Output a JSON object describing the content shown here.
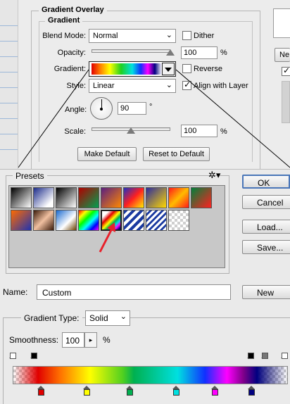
{
  "gradient_overlay": {
    "title": "Gradient Overlay",
    "subtitle": "Gradient",
    "blend_mode_label": "Blend Mode:",
    "blend_mode_value": "Normal",
    "dither_label": "Dither",
    "dither_checked": false,
    "opacity_label": "Opacity:",
    "opacity_value": "100",
    "opacity_unit": "%",
    "opacity_level": 1.0,
    "gradient_label": "Gradient:",
    "reverse_label": "Reverse",
    "reverse_checked": false,
    "style_label": "Style:",
    "style_value": "Linear",
    "align_label": "Align with Layer",
    "align_checked": true,
    "angle_label": "Angle:",
    "angle_value": "90",
    "angle_unit": "°",
    "scale_label": "Scale:",
    "scale_value": "100",
    "scale_unit": "%",
    "scale_level": 0.5,
    "make_default_label": "Make Default",
    "reset_default_label": "Reset to Default",
    "right_button_label": "Ne"
  },
  "gradient_editor": {
    "presets_label": "Presets",
    "presets_menu_icon": "gear-icon",
    "ok_label": "OK",
    "cancel_label": "Cancel",
    "load_label": "Load...",
    "save_label": "Save...",
    "name_label": "Name:",
    "name_value": "Custom",
    "new_label": "New",
    "gradient_type_label": "Gradient Type:",
    "gradient_type_value": "Solid",
    "smoothness_label": "Smoothness:",
    "smoothness_value": "100",
    "smoothness_unit": "%"
  },
  "colors": {
    "accent": "#4a76b8",
    "annotation_arrow": "#e8202a",
    "color_stops": [
      "#e00000",
      "#ffff00",
      "#00b050",
      "#00e0e0",
      "#ff00ff",
      "#000080"
    ]
  }
}
